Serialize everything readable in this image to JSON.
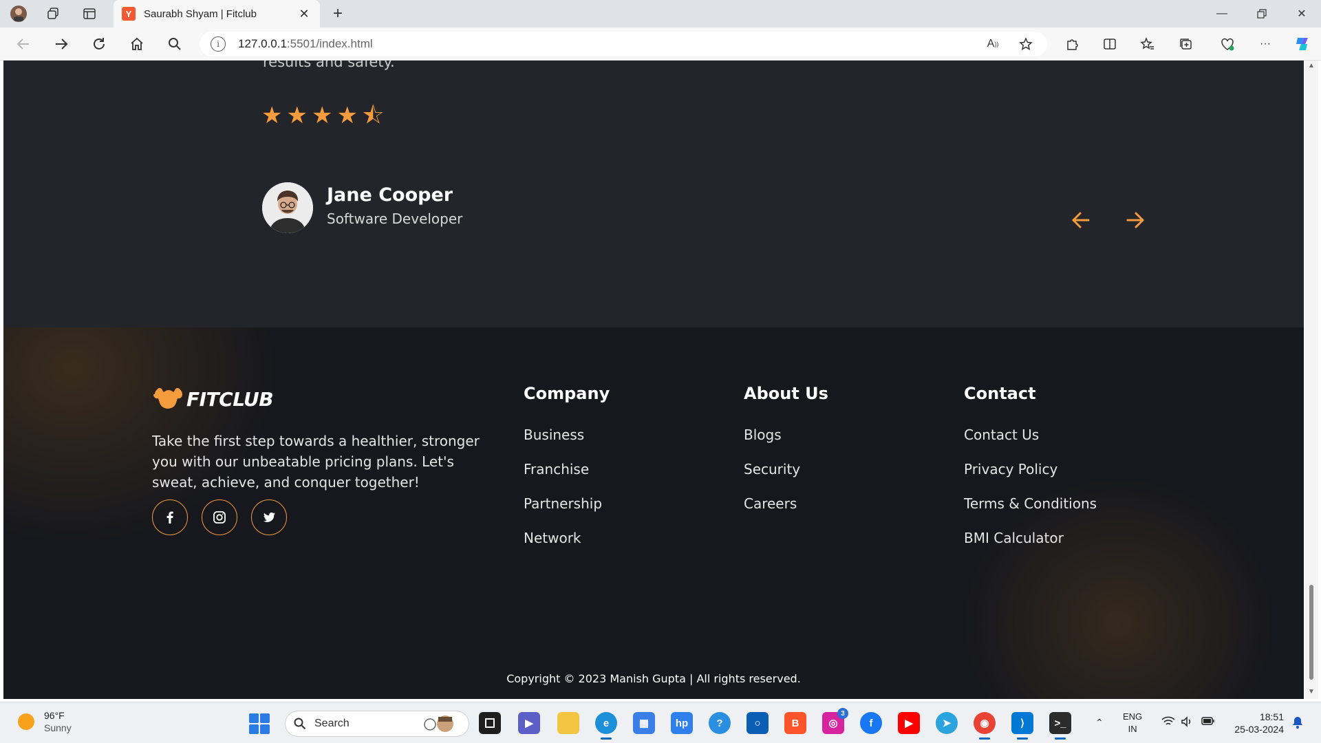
{
  "browser": {
    "tab_title": "Saurabh Shyam | Fitclub",
    "tab_favicon": "Y",
    "url_host": "127.0.0.1",
    "url_rest": ":5501/index.html"
  },
  "testimonial": {
    "text_cut": "results and safety.",
    "rating": 4.5,
    "rating_max": 5,
    "star_full": "★",
    "star_half": "⯪",
    "author_name": "Jane Cooper",
    "author_role": "Software Developer"
  },
  "footer": {
    "logo_text": "FITCLUB",
    "tagline": "Take the first step towards a healthier, stronger you with our unbeatable pricing plans. Let's sweat, achieve, and conquer together!",
    "columns": [
      {
        "title": "Company",
        "links": [
          "Business",
          "Franchise",
          "Partnership",
          "Network"
        ]
      },
      {
        "title": "About Us",
        "links": [
          "Blogs",
          "Security",
          "Careers"
        ]
      },
      {
        "title": "Contact",
        "links": [
          "Contact Us",
          "Privacy Policy",
          "Terms & Conditions",
          "BMI Calculator"
        ]
      }
    ],
    "copyright": "Copyright © 2023 Manish Gupta | All rights reserved."
  },
  "taskbar": {
    "weather_temp": "96°F",
    "weather_desc": "Sunny",
    "search_label": "Search",
    "instagram_badge": "3",
    "lang_top": "ENG",
    "lang_bottom": "IN",
    "time": "18:51",
    "date": "25-03-2024"
  },
  "colors": {
    "accent": "#f49b3d",
    "page_bg": "#24252a",
    "footer_bg": "#17181d"
  }
}
